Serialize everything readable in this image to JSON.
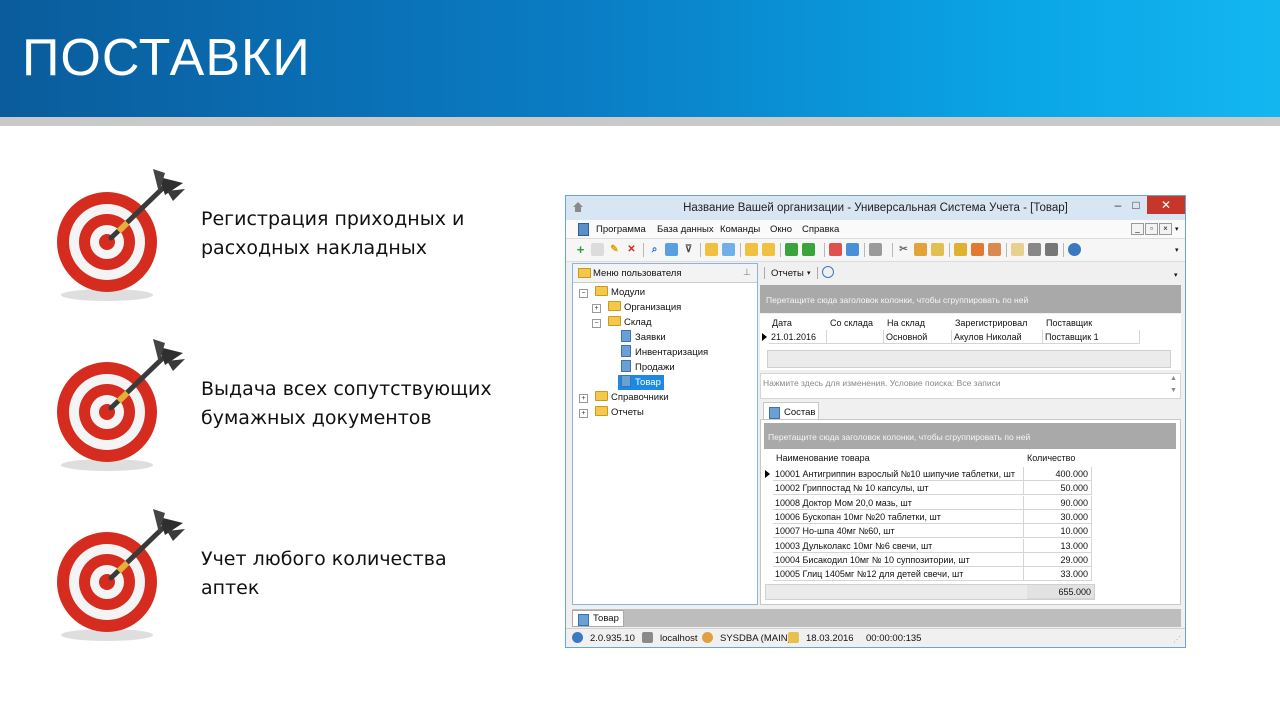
{
  "slide": {
    "title": "ПОСТАВКИ",
    "bullets": [
      {
        "line1": "Регистрация приходных и",
        "line2": "расходных накладных"
      },
      {
        "line1": "Выдача всех сопутствующих",
        "line2": "бумажных документов"
      },
      {
        "line1": "Учет любого количества",
        "line2": "аптек"
      }
    ]
  },
  "window": {
    "title": "Название Вашей организации - Универсальная Система Учета - [Товар]",
    "controls": {
      "minimize": "–",
      "maximize": "□",
      "close": "✕"
    }
  },
  "menu": [
    "Программа",
    "База данных",
    "Команды",
    "Окно",
    "Справка"
  ],
  "left_panel": {
    "title": "Меню пользователя",
    "tree": [
      {
        "label": "Модули",
        "level": 0,
        "expander": "−",
        "icon": "folder"
      },
      {
        "label": "Организация",
        "level": 1,
        "expander": "+",
        "icon": "folder"
      },
      {
        "label": "Склад",
        "level": 1,
        "expander": "−",
        "icon": "folder"
      },
      {
        "label": "Заявки",
        "level": 2,
        "expander": "",
        "icon": "document"
      },
      {
        "label": "Инвентаризация",
        "level": 2,
        "expander": "",
        "icon": "document"
      },
      {
        "label": "Продажи",
        "level": 2,
        "expander": "",
        "icon": "document"
      },
      {
        "label": "Товар",
        "level": 2,
        "expander": "",
        "icon": "document",
        "selected": true
      },
      {
        "label": "Справочники",
        "level": 0,
        "expander": "+",
        "icon": "folder"
      },
      {
        "label": "Отчеты",
        "level": 0,
        "expander": "+",
        "icon": "folder"
      }
    ]
  },
  "reports_button": "Отчеты",
  "group_hint": "Перетащите сюда заголовок колонки, чтобы сгруппировать по ней",
  "top_grid": {
    "columns": [
      "Дата",
      "Со склада",
      "На склад",
      "Зарегистрировал",
      "Поставщик"
    ],
    "rows": [
      [
        "21.01.2016",
        "",
        "Основной",
        "Акулов Николай",
        "Поставщик 1"
      ]
    ]
  },
  "filter_hint": "Нажмите здесь для изменения. Условие поиска: Все записи",
  "detail_tab": "Состав",
  "bottom_grid": {
    "columns": [
      "Наименование товара",
      "Количество"
    ],
    "rows": [
      [
        "10001 Антигриппин взрослый №10 шипучие таблетки, шт",
        "400.000"
      ],
      [
        "10002 Гриппостад № 10 капсулы, шт",
        "50.000"
      ],
      [
        "10008 Доктор Мом 20,0 мазь, шт",
        "90.000"
      ],
      [
        "10006 Бускопан 10мг №20 таблетки, шт",
        "30.000"
      ],
      [
        "10007 Но-шпа 40мг №60, шт",
        "10.000"
      ],
      [
        "10003 Дульколакс 10мг №6 свечи, шт",
        "13.000"
      ],
      [
        "10004 Бисакодил 10мг № 10 суппозитории, шт",
        "29.000"
      ],
      [
        "10005 Глиц 1405мг №12 для детей свечи, шт",
        "33.000"
      ]
    ],
    "total": "655.000"
  },
  "task_tab": "Товар",
  "status": {
    "version": "2.0.935.10",
    "host": "localhost",
    "user": "SYSDBA (MAIN)",
    "date": "18.03.2016",
    "timer": "00:00:00:135"
  },
  "colors": {
    "accent": "#0a7cc4",
    "selection": "#1e88e5",
    "close": "#c7362b",
    "target_red": "#d62b1f"
  }
}
